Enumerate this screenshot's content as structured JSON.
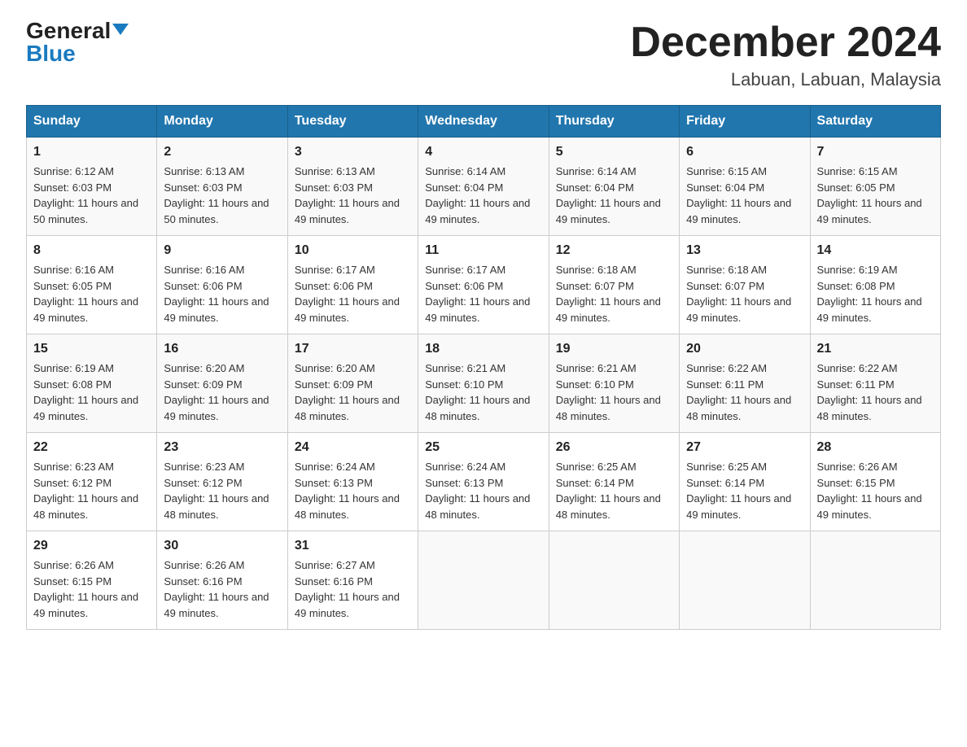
{
  "logo": {
    "general": "General",
    "blue": "Blue"
  },
  "header": {
    "month": "December 2024",
    "location": "Labuan, Labuan, Malaysia"
  },
  "columns": [
    "Sunday",
    "Monday",
    "Tuesday",
    "Wednesday",
    "Thursday",
    "Friday",
    "Saturday"
  ],
  "weeks": [
    [
      {
        "day": "1",
        "sunrise": "6:12 AM",
        "sunset": "6:03 PM",
        "daylight": "11 hours and 50 minutes."
      },
      {
        "day": "2",
        "sunrise": "6:13 AM",
        "sunset": "6:03 PM",
        "daylight": "11 hours and 50 minutes."
      },
      {
        "day": "3",
        "sunrise": "6:13 AM",
        "sunset": "6:03 PM",
        "daylight": "11 hours and 49 minutes."
      },
      {
        "day": "4",
        "sunrise": "6:14 AM",
        "sunset": "6:04 PM",
        "daylight": "11 hours and 49 minutes."
      },
      {
        "day": "5",
        "sunrise": "6:14 AM",
        "sunset": "6:04 PM",
        "daylight": "11 hours and 49 minutes."
      },
      {
        "day": "6",
        "sunrise": "6:15 AM",
        "sunset": "6:04 PM",
        "daylight": "11 hours and 49 minutes."
      },
      {
        "day": "7",
        "sunrise": "6:15 AM",
        "sunset": "6:05 PM",
        "daylight": "11 hours and 49 minutes."
      }
    ],
    [
      {
        "day": "8",
        "sunrise": "6:16 AM",
        "sunset": "6:05 PM",
        "daylight": "11 hours and 49 minutes."
      },
      {
        "day": "9",
        "sunrise": "6:16 AM",
        "sunset": "6:06 PM",
        "daylight": "11 hours and 49 minutes."
      },
      {
        "day": "10",
        "sunrise": "6:17 AM",
        "sunset": "6:06 PM",
        "daylight": "11 hours and 49 minutes."
      },
      {
        "day": "11",
        "sunrise": "6:17 AM",
        "sunset": "6:06 PM",
        "daylight": "11 hours and 49 minutes."
      },
      {
        "day": "12",
        "sunrise": "6:18 AM",
        "sunset": "6:07 PM",
        "daylight": "11 hours and 49 minutes."
      },
      {
        "day": "13",
        "sunrise": "6:18 AM",
        "sunset": "6:07 PM",
        "daylight": "11 hours and 49 minutes."
      },
      {
        "day": "14",
        "sunrise": "6:19 AM",
        "sunset": "6:08 PM",
        "daylight": "11 hours and 49 minutes."
      }
    ],
    [
      {
        "day": "15",
        "sunrise": "6:19 AM",
        "sunset": "6:08 PM",
        "daylight": "11 hours and 49 minutes."
      },
      {
        "day": "16",
        "sunrise": "6:20 AM",
        "sunset": "6:09 PM",
        "daylight": "11 hours and 49 minutes."
      },
      {
        "day": "17",
        "sunrise": "6:20 AM",
        "sunset": "6:09 PM",
        "daylight": "11 hours and 48 minutes."
      },
      {
        "day": "18",
        "sunrise": "6:21 AM",
        "sunset": "6:10 PM",
        "daylight": "11 hours and 48 minutes."
      },
      {
        "day": "19",
        "sunrise": "6:21 AM",
        "sunset": "6:10 PM",
        "daylight": "11 hours and 48 minutes."
      },
      {
        "day": "20",
        "sunrise": "6:22 AM",
        "sunset": "6:11 PM",
        "daylight": "11 hours and 48 minutes."
      },
      {
        "day": "21",
        "sunrise": "6:22 AM",
        "sunset": "6:11 PM",
        "daylight": "11 hours and 48 minutes."
      }
    ],
    [
      {
        "day": "22",
        "sunrise": "6:23 AM",
        "sunset": "6:12 PM",
        "daylight": "11 hours and 48 minutes."
      },
      {
        "day": "23",
        "sunrise": "6:23 AM",
        "sunset": "6:12 PM",
        "daylight": "11 hours and 48 minutes."
      },
      {
        "day": "24",
        "sunrise": "6:24 AM",
        "sunset": "6:13 PM",
        "daylight": "11 hours and 48 minutes."
      },
      {
        "day": "25",
        "sunrise": "6:24 AM",
        "sunset": "6:13 PM",
        "daylight": "11 hours and 48 minutes."
      },
      {
        "day": "26",
        "sunrise": "6:25 AM",
        "sunset": "6:14 PM",
        "daylight": "11 hours and 48 minutes."
      },
      {
        "day": "27",
        "sunrise": "6:25 AM",
        "sunset": "6:14 PM",
        "daylight": "11 hours and 49 minutes."
      },
      {
        "day": "28",
        "sunrise": "6:26 AM",
        "sunset": "6:15 PM",
        "daylight": "11 hours and 49 minutes."
      }
    ],
    [
      {
        "day": "29",
        "sunrise": "6:26 AM",
        "sunset": "6:15 PM",
        "daylight": "11 hours and 49 minutes."
      },
      {
        "day": "30",
        "sunrise": "6:26 AM",
        "sunset": "6:16 PM",
        "daylight": "11 hours and 49 minutes."
      },
      {
        "day": "31",
        "sunrise": "6:27 AM",
        "sunset": "6:16 PM",
        "daylight": "11 hours and 49 minutes."
      },
      null,
      null,
      null,
      null
    ]
  ],
  "labels": {
    "sunrise": "Sunrise:",
    "sunset": "Sunset:",
    "daylight": "Daylight:"
  }
}
